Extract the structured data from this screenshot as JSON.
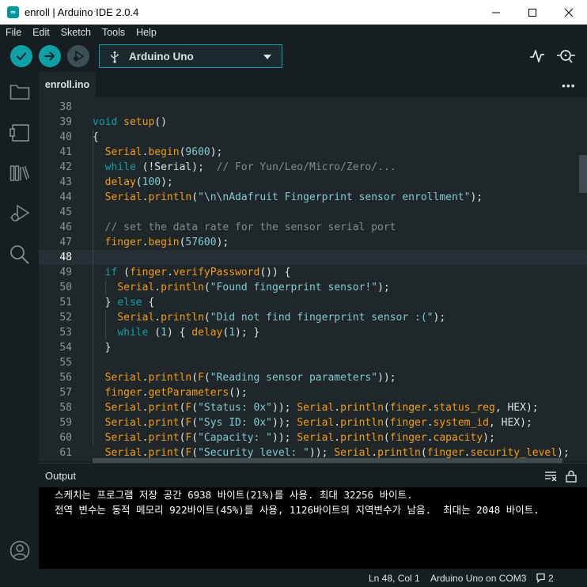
{
  "window": {
    "title": "enroll | Arduino IDE 2.0.4",
    "icons": {
      "logo": "arduino-logo-icon",
      "minimize": "minimize-icon",
      "maximize": "maximize-icon",
      "close": "close-icon"
    }
  },
  "menu": [
    "File",
    "Edit",
    "Sketch",
    "Tools",
    "Help"
  ],
  "toolbar": {
    "board": "Arduino Uno",
    "icons": [
      "verify-icon",
      "upload-icon",
      "debug-icon",
      "usb-icon",
      "chevron-down-icon",
      "serial-plotter-icon",
      "serial-monitor-icon"
    ]
  },
  "sidebar": {
    "icons": [
      "sketchbook-folder-icon",
      "boards-manager-icon",
      "library-manager-icon",
      "debug-icon",
      "search-icon",
      "account-icon"
    ]
  },
  "tabs": [
    {
      "label": "enroll.ino",
      "active": true
    }
  ],
  "tab_more": "•••",
  "editor": {
    "current_line": 48,
    "lines": [
      {
        "num": "38",
        "html": ""
      },
      {
        "num": "39",
        "html": "<span class='k-type'>void</span> <span class='k-fn'>setup</span><span class='k-plain'>()</span>"
      },
      {
        "num": "40",
        "html": "<span class='k-plain'>{</span>"
      },
      {
        "num": "41",
        "html": "  <span class='k-obj'>Serial</span><span class='k-plain'>.</span><span class='k-fn'>begin</span><span class='k-plain'>(</span><span class='k-num'>9600</span><span class='k-plain'>);</span>"
      },
      {
        "num": "42",
        "html": "  <span class='k-kw'>while</span> <span class='k-plain'>(!</span><span class='k-plain'>Serial</span><span class='k-plain'>);</span>  <span class='k-com'>// For Yun/Leo/Micro/Zero/...</span>"
      },
      {
        "num": "43",
        "html": "  <span class='k-fn'>delay</span><span class='k-plain'>(</span><span class='k-num'>100</span><span class='k-plain'>);</span>"
      },
      {
        "num": "44",
        "html": "  <span class='k-obj'>Serial</span><span class='k-plain'>.</span><span class='k-fn'>println</span><span class='k-plain'>(</span><span class='k-str'>\"\\n\\nAdafruit Fingerprint sensor enrollment\"</span><span class='k-plain'>);</span>"
      },
      {
        "num": "45",
        "html": ""
      },
      {
        "num": "46",
        "html": "  <span class='k-com'>// set the data rate for the sensor serial port</span>"
      },
      {
        "num": "47",
        "html": "  <span class='k-obj'>finger</span><span class='k-plain'>.</span><span class='k-fn'>begin</span><span class='k-plain'>(</span><span class='k-num'>57600</span><span class='k-plain'>);</span>"
      },
      {
        "num": "48",
        "html": ""
      },
      {
        "num": "49",
        "html": "  <span class='k-kw'>if</span> <span class='k-plain'>(</span><span class='k-obj'>finger</span><span class='k-plain'>.</span><span class='k-fn'>verifyPassword</span><span class='k-plain'>()) {</span>"
      },
      {
        "num": "50",
        "html": "    <span class='k-obj'>Serial</span><span class='k-plain'>.</span><span class='k-fn'>println</span><span class='k-plain'>(</span><span class='k-str'>\"Found fingerprint sensor!\"</span><span class='k-plain'>);</span>"
      },
      {
        "num": "51",
        "html": "  <span class='k-plain'>} </span><span class='k-kw'>else</span><span class='k-plain'> {</span>"
      },
      {
        "num": "52",
        "html": "    <span class='k-obj'>Serial</span><span class='k-plain'>.</span><span class='k-fn'>println</span><span class='k-plain'>(</span><span class='k-str'>\"Did not find fingerprint sensor :(\"</span><span class='k-plain'>);</span>"
      },
      {
        "num": "53",
        "html": "    <span class='k-kw'>while</span> <span class='k-plain'>(</span><span class='k-num'>1</span><span class='k-plain'>) { </span><span class='k-fn'>delay</span><span class='k-plain'>(</span><span class='k-num'>1</span><span class='k-plain'>); }</span>"
      },
      {
        "num": "54",
        "html": "  <span class='k-plain'>}</span>"
      },
      {
        "num": "55",
        "html": ""
      },
      {
        "num": "56",
        "html": "  <span class='k-obj'>Serial</span><span class='k-plain'>.</span><span class='k-fn'>println</span><span class='k-plain'>(</span><span class='k-fn'>F</span><span class='k-plain'>(</span><span class='k-str'>\"Reading sensor parameters\"</span><span class='k-plain'>));</span>"
      },
      {
        "num": "57",
        "html": "  <span class='k-obj'>finger</span><span class='k-plain'>.</span><span class='k-fn'>getParameters</span><span class='k-plain'>();</span>"
      },
      {
        "num": "58",
        "html": "  <span class='k-obj'>Serial</span><span class='k-plain'>.</span><span class='k-fn'>print</span><span class='k-plain'>(</span><span class='k-fn'>F</span><span class='k-plain'>(</span><span class='k-str'>\"Status: 0x\"</span><span class='k-plain'>)); </span><span class='k-obj'>Serial</span><span class='k-plain'>.</span><span class='k-fn'>println</span><span class='k-plain'>(</span><span class='k-obj'>finger</span><span class='k-plain'>.</span><span class='k-fn'>status_reg</span><span class='k-plain'>, HEX);</span>"
      },
      {
        "num": "59",
        "html": "  <span class='k-obj'>Serial</span><span class='k-plain'>.</span><span class='k-fn'>print</span><span class='k-plain'>(</span><span class='k-fn'>F</span><span class='k-plain'>(</span><span class='k-str'>\"Sys ID: 0x\"</span><span class='k-plain'>)); </span><span class='k-obj'>Serial</span><span class='k-plain'>.</span><span class='k-fn'>println</span><span class='k-plain'>(</span><span class='k-obj'>finger</span><span class='k-plain'>.</span><span class='k-fn'>system_id</span><span class='k-plain'>, HEX);</span>"
      },
      {
        "num": "60",
        "html": "  <span class='k-obj'>Serial</span><span class='k-plain'>.</span><span class='k-fn'>print</span><span class='k-plain'>(</span><span class='k-fn'>F</span><span class='k-plain'>(</span><span class='k-str'>\"Capacity: \"</span><span class='k-plain'>)); </span><span class='k-obj'>Serial</span><span class='k-plain'>.</span><span class='k-fn'>println</span><span class='k-plain'>(</span><span class='k-obj'>finger</span><span class='k-plain'>.</span><span class='k-fn'>capacity</span><span class='k-plain'>);</span>"
      },
      {
        "num": "61",
        "html": "  <span class='k-obj'>Serial</span><span class='k-plain'>.</span><span class='k-fn'>print</span><span class='k-plain'>(</span><span class='k-fn'>F</span><span class='k-plain'>(</span><span class='k-str'>\"Security level: \"</span><span class='k-plain'>)); </span><span class='k-obj'>Serial</span><span class='k-plain'>.</span><span class='k-fn'>println</span><span class='k-plain'>(</span><span class='k-obj'>finger</span><span class='k-plain'>.</span><span class='k-fn'>security_level</span><span class='k-plain'>);</span>"
      }
    ]
  },
  "output": {
    "title": "Output",
    "icons": [
      "clear-output-icon",
      "lock-scroll-icon"
    ],
    "lines": [
      "스케치는 프로그램 저장 공간 6938 바이트(21%)를 사용. 최대 32256 바이트.",
      "전역 변수는 동적 메모리 922바이트(45%)를 사용, 1126바이트의 지역변수가 남음.  최대는 2048 바이트."
    ]
  },
  "status": {
    "position": "Ln 48, Col 1",
    "board_port": "Arduino Uno on COM3",
    "notifications": "2",
    "icons": [
      "notification-icon"
    ]
  }
}
